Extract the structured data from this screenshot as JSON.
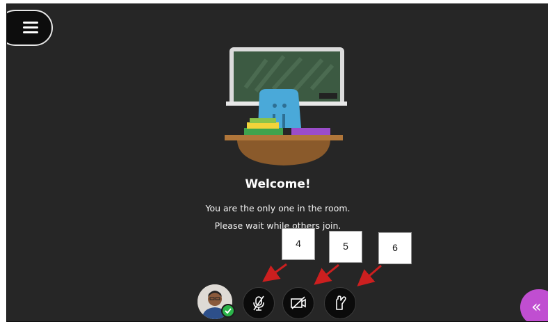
{
  "welcome": {
    "title": "Welcome!",
    "line1": "You are the only one in the room.",
    "line2": "Please wait while others join."
  },
  "callouts": [
    "4",
    "5",
    "6"
  ],
  "controls": {
    "menu_icon": "hamburger-icon",
    "microphone_icon": "microphone-muted-icon",
    "camera_icon": "camera-off-icon",
    "hand_icon": "raise-hand-icon",
    "collapse_icon": "double-chevron-left-icon",
    "status_icon": "check-icon"
  },
  "colors": {
    "background": "#262626",
    "button": "#0b0b0b",
    "arrow": "#cc1f1f",
    "collapse": "#c04ed1",
    "status": "#2bb44a"
  }
}
